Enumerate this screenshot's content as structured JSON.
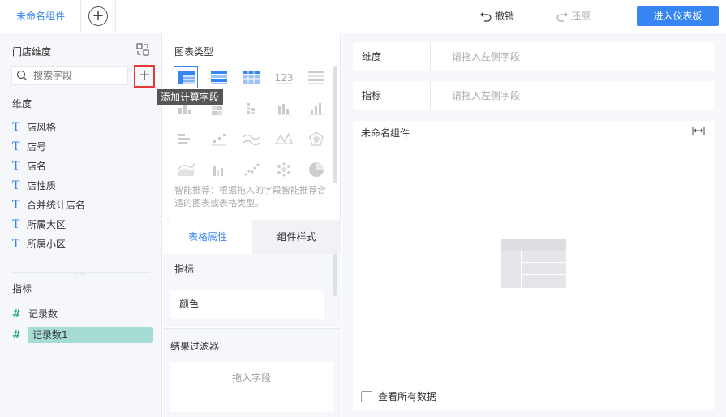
{
  "topbar": {
    "active_tab": "未命名组件",
    "undo_label": "撤销",
    "redo_label": "还原",
    "enter_dashboard_label": "进入仪表板"
  },
  "left_panel": {
    "title": "门店维度",
    "search_placeholder": "搜索字段",
    "add_calc_tooltip": "添加计算字段",
    "dimension_label": "维度",
    "dimensions": [
      "店风格",
      "店号",
      "店名",
      "店性质",
      "合并统计店名",
      "所属大区",
      "所属小区"
    ],
    "measure_label": "指标",
    "measures": [
      "记录数",
      "记录数1"
    ],
    "dimension_icon": "T",
    "measure_icon": "#"
  },
  "middle_panel": {
    "chart_type_title": "图表类型",
    "chart_type_123": "123",
    "hint": "智能推荐：根据拖入的字段智能推荐合适的图表或表格类型。",
    "tabs": [
      "表格属性",
      "组件样式"
    ],
    "prop_label": "指标",
    "prop_color": "颜色",
    "filter_label": "结果过滤器",
    "filter_drop": "拖入字段"
  },
  "right_panel": {
    "dimension_label": "维度",
    "dimension_placeholder": "请拖入左侧字段",
    "measure_label": "指标",
    "measure_placeholder": "请拖入左侧字段",
    "canvas_title": "未命名组件",
    "view_all_label": "查看所有数据"
  },
  "colors": {
    "accent": "#3685f2",
    "measure_icon": "#2aa88e",
    "selected_field_bg": "#a7dcd4",
    "highlight_border": "#e53935"
  }
}
